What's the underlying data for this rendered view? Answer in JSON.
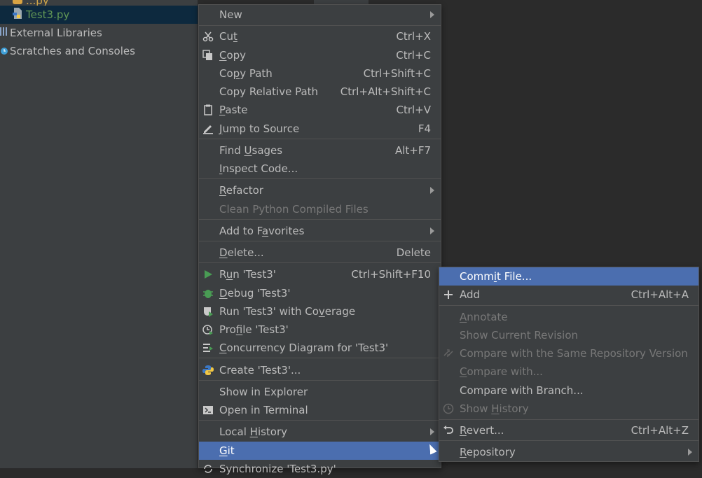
{
  "project_tree": {
    "top_partial_label": "...py",
    "items": [
      {
        "label": "Test3.py",
        "icon": "python-file-icon"
      },
      {
        "label": "External Libraries",
        "icon": "library-icon"
      },
      {
        "label": "Scratches and Consoles",
        "icon": "scratches-icon"
      }
    ]
  },
  "context_menu": {
    "items": {
      "new": {
        "pre": "",
        "u": "",
        "post": "New",
        "shortcut": ""
      },
      "cut": {
        "pre": "Cu",
        "u": "t",
        "post": "",
        "shortcut": "Ctrl+X"
      },
      "copy": {
        "pre": "",
        "u": "C",
        "post": "opy",
        "shortcut": "Ctrl+C"
      },
      "copy_path": {
        "pre": "Co",
        "u": "p",
        "post": "y Path",
        "shortcut": "Ctrl+Shift+C"
      },
      "copy_relative_path": {
        "pre": "Copy",
        "u": "",
        "post": " Relative Path",
        "shortcut": "Ctrl+Alt+Shift+C"
      },
      "paste": {
        "pre": "",
        "u": "P",
        "post": "aste",
        "shortcut": "Ctrl+V"
      },
      "jump_to_source": {
        "pre": "",
        "u": "J",
        "post": "ump to Source",
        "shortcut": "F4"
      },
      "find_usages": {
        "pre": "Find ",
        "u": "U",
        "post": "sages",
        "shortcut": "Alt+F7"
      },
      "inspect_code": {
        "pre": "",
        "u": "I",
        "post": "nspect Code...",
        "shortcut": ""
      },
      "refactor": {
        "pre": "",
        "u": "R",
        "post": "efactor",
        "shortcut": ""
      },
      "clean_python": {
        "pre": "",
        "u": "",
        "post": "Clean Python Compiled Files",
        "shortcut": ""
      },
      "add_to_favorites": {
        "pre": "Add to F",
        "u": "a",
        "post": "vorites",
        "shortcut": ""
      },
      "delete": {
        "pre": "",
        "u": "D",
        "post": "elete...",
        "shortcut": "Delete"
      },
      "run": {
        "pre": "R",
        "u": "u",
        "post": "n 'Test3'",
        "shortcut": "Ctrl+Shift+F10"
      },
      "debug": {
        "pre": "",
        "u": "D",
        "post": "ebug 'Test3'",
        "shortcut": ""
      },
      "run_coverage": {
        "pre": "Run 'Test3' with Co",
        "u": "v",
        "post": "erage",
        "shortcut": ""
      },
      "profile": {
        "pre": "Pro",
        "u": "f",
        "post": "ile 'Test3'",
        "shortcut": ""
      },
      "concurrency": {
        "pre": "",
        "u": "C",
        "post": "oncurrency Diagram for 'Test3'",
        "shortcut": ""
      },
      "create": {
        "pre": "Create 'Test3'...",
        "u": "",
        "post": "",
        "shortcut": ""
      },
      "show_in_explorer": {
        "pre": "Show in Explorer",
        "u": "",
        "post": "",
        "shortcut": ""
      },
      "open_in_terminal": {
        "pre": "Open in Terminal",
        "u": "",
        "post": "",
        "shortcut": ""
      },
      "local_history": {
        "pre": "Local ",
        "u": "H",
        "post": "istory",
        "shortcut": ""
      },
      "git": {
        "pre": "",
        "u": "G",
        "post": "it",
        "shortcut": ""
      },
      "synchronize": {
        "pre": "Synchronize 'Test3.py'",
        "u": "",
        "post": "",
        "shortcut": ""
      }
    }
  },
  "git_submenu": {
    "items": {
      "commit_file": {
        "pre": "Comm",
        "u": "i",
        "post": "t File...",
        "shortcut": ""
      },
      "add": {
        "pre": "Add",
        "u": "",
        "post": "",
        "shortcut": "Ctrl+Alt+A"
      },
      "annotate": {
        "pre": "",
        "u": "A",
        "post": "nnotate",
        "shortcut": ""
      },
      "show_current_revision": {
        "pre": "Show Current Revision",
        "u": "",
        "post": "",
        "shortcut": ""
      },
      "compare_same_repo": {
        "pre": "Compare with the Same Repository Version",
        "u": "",
        "post": "",
        "shortcut": ""
      },
      "compare_with": {
        "pre": "",
        "u": "C",
        "post": "ompare with...",
        "shortcut": ""
      },
      "compare_with_branch": {
        "pre": "Compare with Branch...",
        "u": "",
        "post": "",
        "shortcut": ""
      },
      "show_history": {
        "pre": "Show ",
        "u": "H",
        "post": "istory",
        "shortcut": ""
      },
      "revert": {
        "pre": "",
        "u": "R",
        "post": "evert...",
        "shortcut": "Ctrl+Alt+Z"
      },
      "repository": {
        "pre": "",
        "u": "R",
        "post": "epository",
        "shortcut": ""
      }
    }
  },
  "colors": {
    "menu_bg": "#3c3f41",
    "highlight": "#4b6eaf",
    "tree_selected": "#0d293e",
    "run_green": "#499c54",
    "disabled_text": "#787878"
  }
}
